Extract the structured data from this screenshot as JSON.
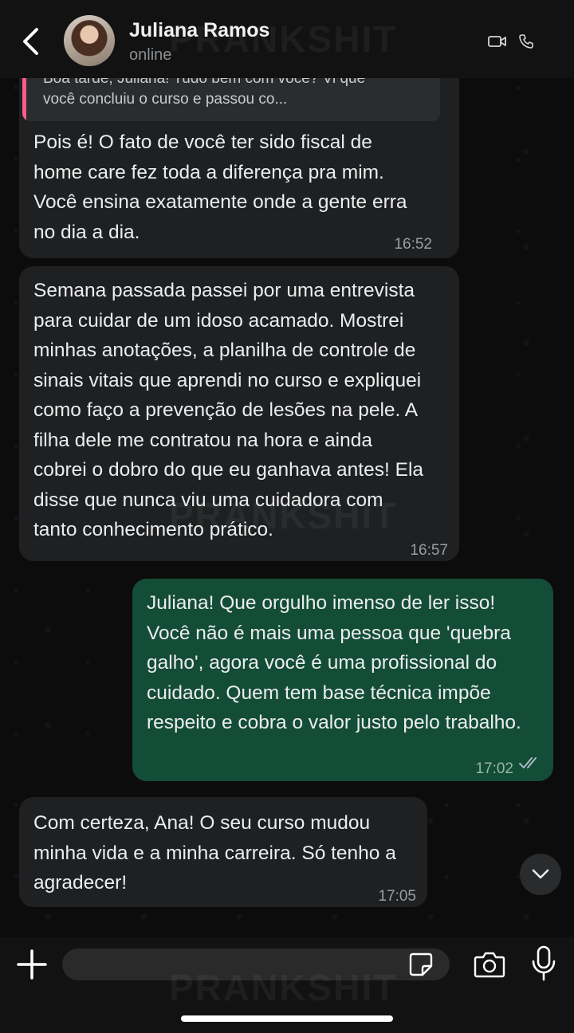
{
  "header": {
    "contact_name": "Juliana Ramos",
    "status": "online"
  },
  "watermark": "PRANKSHIT",
  "quote": {
    "text": "Boa tarde, Juliana! Tudo bem com você? Vi que\nvocê concluiu o curso e passou co..."
  },
  "messages": [
    {
      "direction": "incoming",
      "text": "Pois é! O fato de você ter sido fiscal de\nhome care fez toda a diferença pra mim.\nVocê ensina exatamente onde a gente erra\nno dia a dia.",
      "time": "16:52"
    },
    {
      "direction": "incoming",
      "text": "Semana passada passei por uma entrevista\npara cuidar de um idoso acamado. Mostrei\nminhas anotações, a planilha de controle de\nsinais vitais que aprendi no curso e expliquei\ncomo faço a prevenção de lesões na pele. A\nfilha dele me contratou na hora e ainda\ncobrei o dobro do que eu ganhava antes! Ela\ndisse que nunca viu uma cuidadora com\ntanto conhecimento prático.",
      "time": "16:57"
    },
    {
      "direction": "outgoing",
      "text": "Juliana! Que orgulho imenso de ler isso!\nVocê não é mais uma pessoa que 'quebra\ngalho', agora você é uma profissional do\ncuidado. Quem tem base técnica impõe\nrespeito e cobra o valor justo pelo trabalho.",
      "time": "17:02",
      "read": true
    },
    {
      "direction": "incoming",
      "text": "Com certeza, Ana! O seu curso mudou\nminha vida e a minha carreira. Só tenho a\nagradecer!",
      "time": "17:05"
    }
  ],
  "composer": {
    "input_value": "",
    "placeholder": ""
  },
  "icons": {
    "back": "chevron-left-icon",
    "video": "video-call-icon",
    "phone": "phone-call-icon",
    "scroll": "chevron-down-icon",
    "plus": "plus-icon",
    "sticker": "sticker-icon",
    "camera": "camera-icon",
    "mic": "microphone-icon",
    "read": "double-check-icon"
  },
  "colors": {
    "incoming_bubble": "#1f2021",
    "outgoing_bubble": "#144d37",
    "quote_bar": "#ff5c8a",
    "read_ticks": "#a9b8c8"
  }
}
